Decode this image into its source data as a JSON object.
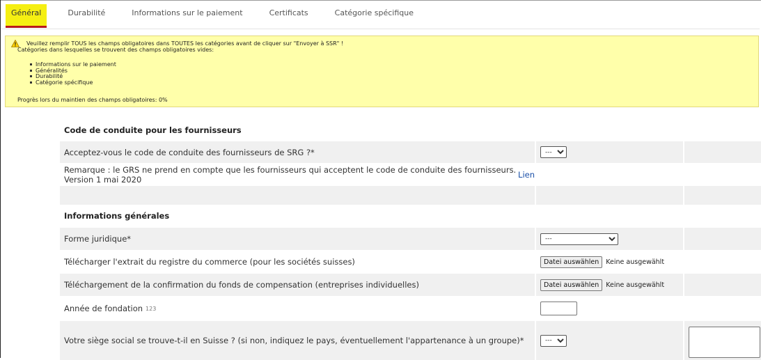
{
  "tabs": [
    {
      "label": "Général",
      "active": true
    },
    {
      "label": "Durabilité",
      "active": false
    },
    {
      "label": "Informations sur le paiement",
      "active": false
    },
    {
      "label": "Certificats",
      "active": false
    },
    {
      "label": "Catégorie spécifique",
      "active": false
    }
  ],
  "warning": {
    "line1": "Veuillez remplir TOUS les champs obligatoires dans TOUTES les catégories avant de cliquer sur \"Envoyer à SSR\" !",
    "line2": "Catégories dans lesquelles se trouvent des champs obligatoires vides:",
    "categories": [
      "Informations sur le paiement",
      "Généralités",
      "Durabilité",
      "Catégorie spécifique"
    ],
    "progress": "Progrès lors du maintien des champs obligatoires: 0%"
  },
  "form": {
    "section1_title": "Code de conduite pour les fournisseurs",
    "q_accept_label": "Acceptez-vous le code de conduite des fournisseurs de SRG ?*",
    "q_accept_value": "---",
    "remark_text": "Remarque : le GRS ne prend en compte que les fournisseurs qui acceptent le code de conduite des fournisseurs. Version 1 mai 2020",
    "remark_link": "Lien",
    "section2_title": "Informations générales",
    "legal_form_label": "Forme juridique*",
    "legal_form_value": "---",
    "upload1_label": "Télécharger l'extrait du registre du commerce (pour les sociétés suisses)",
    "upload2_label": "Téléchargement de la confirmation du fonds de compensation (entreprises individuelles)",
    "file_button": "Datei auswählen",
    "file_status": "Keine ausgewählt",
    "year_label": "Année de fondation",
    "year_hint": "123",
    "hq_label": "Votre siège social se trouve-t-il en Suisse ? (si non, indiquez le pays, éventuellement l'appartenance à un groupe)*",
    "hq_value": "---"
  },
  "colors": {
    "tab_active": "#f5ef12",
    "tab_underline": "#b8181c",
    "warning_bg": "#ffffaa",
    "row_shade": "#f0f0f0",
    "link": "#1a4fa8"
  }
}
